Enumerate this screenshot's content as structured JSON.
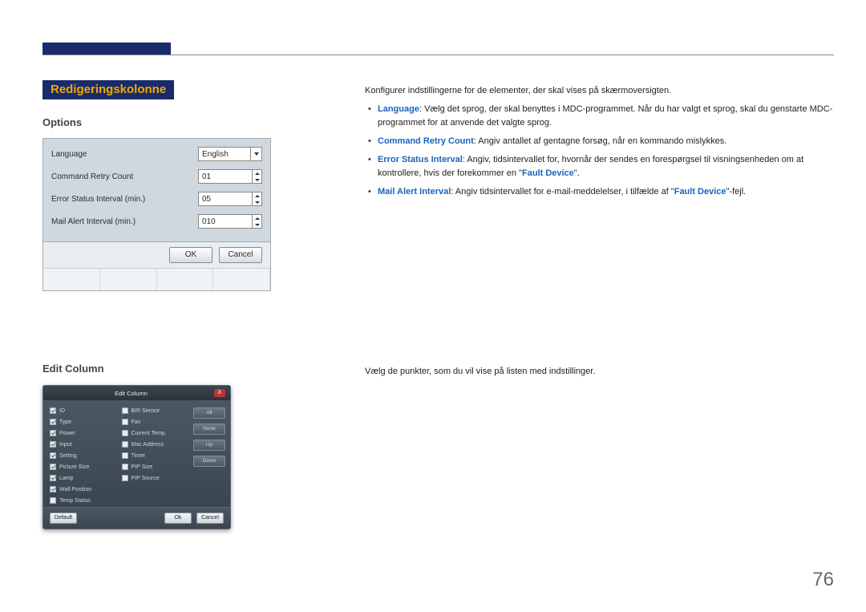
{
  "page_number": "76",
  "section_title": "Redigeringskolonne",
  "options": {
    "heading": "Options",
    "rows": {
      "language_label": "Language",
      "language_value": "English",
      "retry_label": "Command Retry Count",
      "retry_value": "01",
      "error_label": "Error Status Interval (min.)",
      "error_value": "05",
      "mail_label": "Mail Alert Interval (min.)",
      "mail_value": "010"
    },
    "ok": "OK",
    "cancel": "Cancel"
  },
  "options_text": {
    "intro": "Konfigurer indstillingerne for de elementer, der skal vises på skærmoversigten.",
    "b1_hl": "Language",
    "b1_txt": ": Vælg det sprog, der skal benyttes i MDC-programmet. Når du har valgt et sprog, skal du genstarte MDC-programmet for at anvende det valgte sprog.",
    "b2_hl": "Command Retry Count",
    "b2_txt": ": Angiv antallet af gentagne forsøg, når en kommando mislykkes.",
    "b3_hl": "Error Status Interval",
    "b3_txt_a": ": Angiv, tidsintervallet for, hvornår der sendes en forespørgsel til visningsenheden om at kontrollere, hvis der forekommer en \"",
    "b3_hl2": "Fault Device",
    "b3_txt_b": "\".",
    "b4_hl": "Mail Alert Interval",
    "b4_txt_a": ": Angiv tidsintervallet for e-mail-meddelelser, i tilfælde af \"",
    "b4_hl2": "Fault Device",
    "b4_txt_b": "\"-fejl."
  },
  "editcol": {
    "heading": "Edit Column",
    "dialog_title": "Edit Column",
    "left_items": [
      "ID",
      "Type",
      "Power",
      "Input",
      "Setting",
      "Picture Size",
      "Lamp",
      "Wall Position",
      "Temp Status"
    ],
    "left_checked": [
      true,
      true,
      true,
      true,
      true,
      true,
      true,
      true,
      false
    ],
    "right_items": [
      "B/R Sensor",
      "Fan",
      "Current Temp.",
      "Mac Address",
      "Timer",
      "PIP Size",
      "PIP Source"
    ],
    "right_checked": [
      false,
      false,
      false,
      false,
      false,
      false,
      false
    ],
    "btns": {
      "all": "All",
      "none": "None",
      "up": "Up",
      "down": "Down"
    },
    "default": "Default",
    "ok": "Ok",
    "cancel": "Cancel",
    "paragraph": "Vælg de punkter, som du vil vise på listen med indstillinger."
  }
}
